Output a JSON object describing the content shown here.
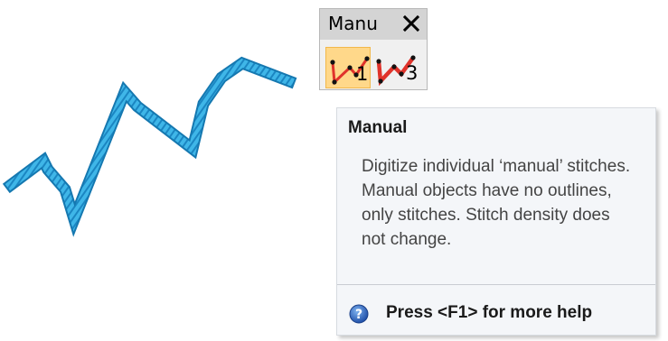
{
  "toolbar": {
    "title": "Manu",
    "close_icon": "close-icon",
    "buttons": [
      {
        "icon": "manual-stitch-icon",
        "number": "1",
        "active": true
      },
      {
        "icon": "manual-stitch-icon",
        "number": "3",
        "active": false
      }
    ]
  },
  "tooltip": {
    "title": "Manual",
    "body": "Digitize individual ‘manual’ stitches. Manual objects have no outlines, only stitches. Stitch density does not change.",
    "help_icon": "help-icon",
    "help_text": "Press <F1> for more help"
  },
  "colors": {
    "stitch": "#36aee2",
    "stitch_dark": "#1a7fb8",
    "active_button": "#ffd88a",
    "tool_line_red": "#e0332b"
  }
}
